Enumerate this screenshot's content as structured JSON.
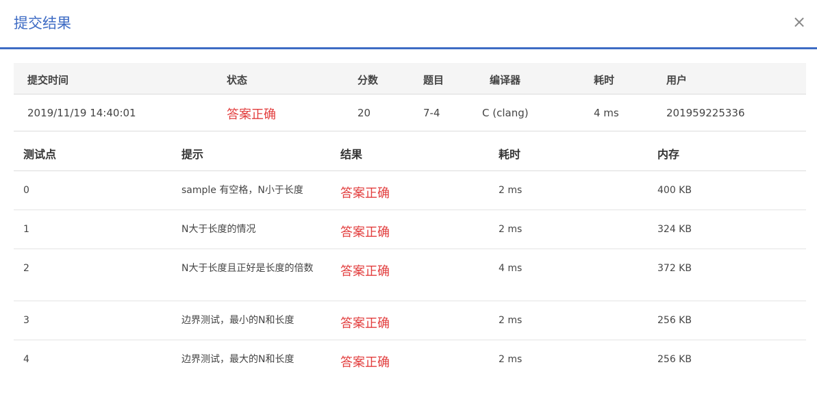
{
  "modal": {
    "title": "提交结果",
    "close_glyph": "×"
  },
  "summary": {
    "headers": {
      "time": "提交时间",
      "status": "状态",
      "score": "分数",
      "problem": "题目",
      "compiler": "编译器",
      "elapsed": "耗时",
      "user": "用户"
    },
    "row": {
      "time": "2019/11/19 14:40:01",
      "status": "答案正确",
      "score": "20",
      "problem": "7-4",
      "compiler": "C (clang)",
      "elapsed": "4 ms",
      "user": "201959225336"
    }
  },
  "cases": {
    "headers": {
      "id": "测试点",
      "hint": "提示",
      "result": "结果",
      "time": "耗时",
      "memory": "内存"
    },
    "rows": [
      {
        "id": "0",
        "hint": "sample 有空格，N小于长度",
        "result": "答案正确",
        "time": "2 ms",
        "memory": "400 KB"
      },
      {
        "id": "1",
        "hint": "N大于长度的情况",
        "result": "答案正确",
        "time": "2 ms",
        "memory": "324 KB"
      },
      {
        "id": "2",
        "hint": "N大于长度且正好是长度的倍数",
        "result": "答案正确",
        "time": "4 ms",
        "memory": "372 KB"
      },
      {
        "id": "3",
        "hint": "边界测试，最小的N和长度",
        "result": "答案正确",
        "time": "2 ms",
        "memory": "256 KB"
      },
      {
        "id": "4",
        "hint": "边界测试，最大的N和长度",
        "result": "答案正确",
        "time": "2 ms",
        "memory": "256 KB"
      }
    ]
  },
  "colors": {
    "accent": "#3d6bc4",
    "success": "#e23d3d",
    "link": "#2e6fb8"
  }
}
